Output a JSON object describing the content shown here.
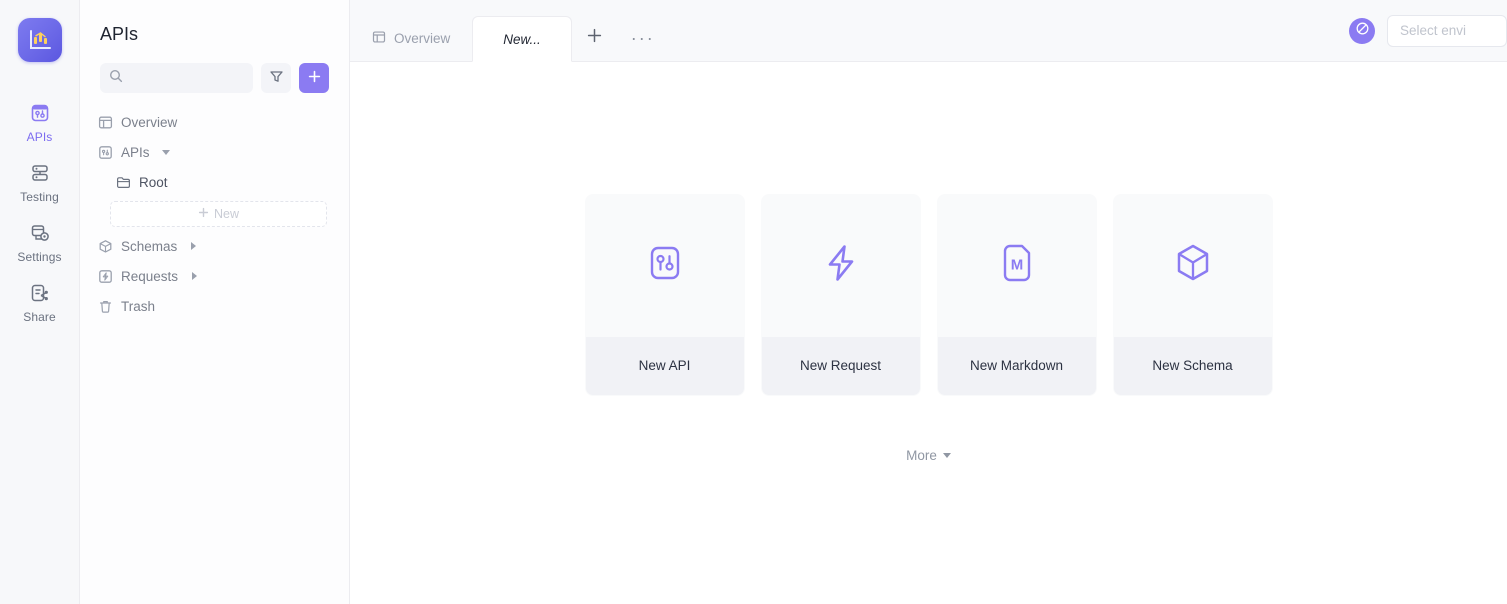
{
  "rail": {
    "logo_icon": "chart-logo-icon",
    "items": [
      {
        "label": "APIs",
        "icon": "apis-icon",
        "active": true
      },
      {
        "label": "Testing",
        "icon": "testing-icon",
        "active": false
      },
      {
        "label": "Settings",
        "icon": "settings-icon",
        "active": false
      },
      {
        "label": "Share",
        "icon": "share-icon",
        "active": false
      }
    ]
  },
  "sidebar": {
    "title": "APIs",
    "search": {
      "value": "",
      "placeholder": ""
    },
    "filter_icon": "filter-icon",
    "add_icon": "plus-icon",
    "tree": [
      {
        "label": "Overview",
        "icon": "overview-icon",
        "indent": 0,
        "caret": "none"
      },
      {
        "label": "APIs",
        "icon": "apis-tree-icon",
        "indent": 0,
        "caret": "down"
      },
      {
        "label": "Root",
        "icon": "folder-icon",
        "indent": 1,
        "caret": "none"
      }
    ],
    "new_button": {
      "label": "New",
      "icon": "plus-icon"
    },
    "tree_bottom": [
      {
        "label": "Schemas",
        "icon": "schema-cube-icon",
        "indent": 0,
        "caret": "right"
      },
      {
        "label": "Requests",
        "icon": "requests-icon",
        "indent": 0,
        "caret": "right"
      },
      {
        "label": "Trash",
        "icon": "trash-icon",
        "indent": 0,
        "caret": "none"
      }
    ]
  },
  "tabbar": {
    "tabs": [
      {
        "label": "Overview",
        "icon": "overview-icon",
        "active": false
      },
      {
        "label": "New...",
        "icon": "",
        "active": true
      }
    ],
    "add_tab_label": "+",
    "more_tabs_label": "···",
    "env_avatar_icon": "environment-globe-icon",
    "env_select_text": "Select envi"
  },
  "content": {
    "cards": [
      {
        "label": "New API",
        "icon": "api-sliders-icon"
      },
      {
        "label": "New Request",
        "icon": "lightning-bolt-icon"
      },
      {
        "label": "New Markdown",
        "icon": "markdown-file-icon"
      },
      {
        "label": "New Schema",
        "icon": "schema-cube-icon"
      }
    ],
    "more_label": "More"
  },
  "colors": {
    "accent": "#8b7bf2",
    "accent_soft": "#7c6cf0",
    "rail_bg": "#f7f8fa",
    "card_bg": "#f9fafb",
    "card_label_bg": "#f1f2f6",
    "text_primary": "#2c3242",
    "text_muted": "#9097a3"
  }
}
